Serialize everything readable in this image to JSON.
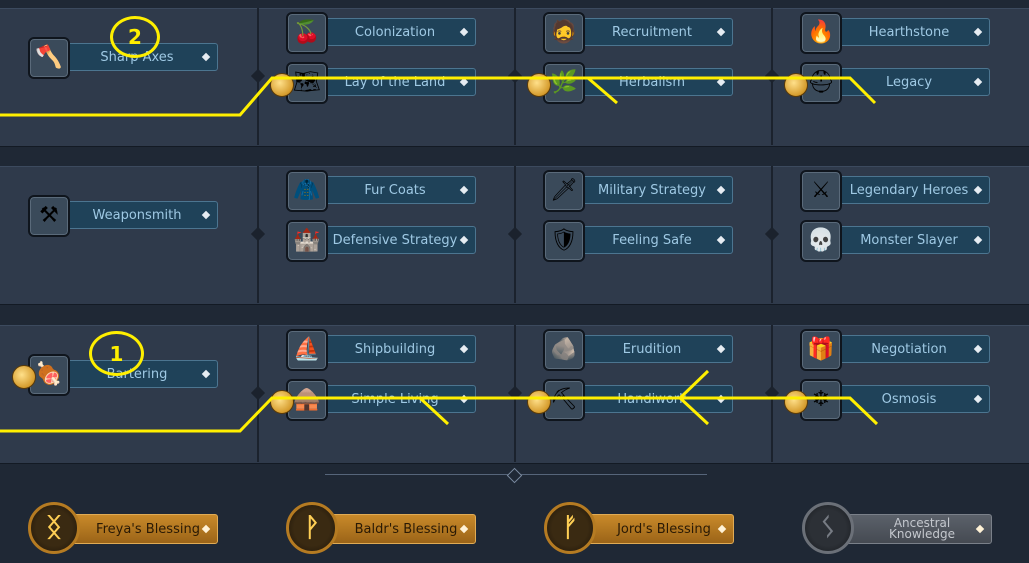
{
  "rows": [
    {
      "columns": [
        [
          {
            "label": "Sharp Axes",
            "icon": "axe-icon",
            "glyph": "🪓",
            "coin": false
          }
        ],
        [
          {
            "label": "Colonization",
            "icon": "food-bowl-icon",
            "glyph": "🍒",
            "coin": false
          },
          {
            "label": "Lay of the Land",
            "icon": "map-icon",
            "glyph": "🗺",
            "coin": true
          }
        ],
        [
          {
            "label": "Recruitment",
            "icon": "warrior-portrait-icon",
            "glyph": "🧔",
            "coin": false
          },
          {
            "label": "Herbalism",
            "icon": "herb-icon",
            "glyph": "🌿",
            "coin": true
          }
        ],
        [
          {
            "label": "Hearthstone",
            "icon": "fire-icon",
            "glyph": "🔥",
            "coin": false
          },
          {
            "label": "Legacy",
            "icon": "horned-helmet-icon",
            "glyph": "⛑",
            "coin": true
          }
        ]
      ]
    },
    {
      "columns": [
        [
          {
            "label": "Weaponsmith",
            "icon": "anvil-icon",
            "glyph": "⚒",
            "coin": false
          }
        ],
        [
          {
            "label": "Fur Coats",
            "icon": "fur-icon",
            "glyph": "🧥",
            "coin": false
          },
          {
            "label": "Defensive Strategy",
            "icon": "watchtower-icon",
            "glyph": "🏰",
            "coin": false
          }
        ],
        [
          {
            "label": "Military Strategy",
            "icon": "sword-icon",
            "glyph": "🗡",
            "coin": false
          },
          {
            "label": "Feeling Safe",
            "icon": "shield-icon",
            "glyph": "🛡",
            "coin": false
          }
        ],
        [
          {
            "label": "Legendary Heroes",
            "icon": "double-axe-icon",
            "glyph": "⚔",
            "coin": false
          },
          {
            "label": "Monster Slayer",
            "icon": "skull-icon",
            "glyph": "💀",
            "coin": false
          }
        ]
      ]
    },
    {
      "columns": [
        [
          {
            "label": "Bartering",
            "icon": "meat-icon",
            "glyph": "🍖",
            "coin": true
          }
        ],
        [
          {
            "label": "Shipbuilding",
            "icon": "longship-icon",
            "glyph": "⛵",
            "coin": false
          },
          {
            "label": "Simple Living",
            "icon": "hut-icon",
            "glyph": "🛖",
            "coin": true
          }
        ],
        [
          {
            "label": "Erudition",
            "icon": "runestone-icon",
            "glyph": "🪨",
            "coin": false
          },
          {
            "label": "Handiwork",
            "icon": "tool-icon",
            "glyph": "⛏",
            "coin": true
          }
        ],
        [
          {
            "label": "Negotiation",
            "icon": "chest-icon",
            "glyph": "🎁",
            "coin": false
          },
          {
            "label": "Osmosis",
            "icon": "knot-icon",
            "glyph": "❄",
            "coin": true
          }
        ]
      ]
    }
  ],
  "blessings": [
    {
      "label": "Freya's Blessing",
      "rune": "ᛝ",
      "icon": "rune-freya-icon",
      "locked": false
    },
    {
      "label": "Baldr's Blessing",
      "rune": "ᚹ",
      "icon": "rune-baldr-icon",
      "locked": false
    },
    {
      "label": "Jord's Blessing",
      "rune": "ᚠ",
      "icon": "rune-jord-icon",
      "locked": false
    },
    {
      "label": "Ancestral Knowledge",
      "rune": "ᛊ",
      "icon": "rune-ancestral-icon",
      "locked": true
    }
  ],
  "annotations": [
    "2",
    "1"
  ],
  "colors": {
    "panel": "#2f3a4b",
    "node_bar": "#1f4259",
    "node_text": "#9fc9e4",
    "blessing": "#c98a2a",
    "annotation": "#ffef00"
  }
}
